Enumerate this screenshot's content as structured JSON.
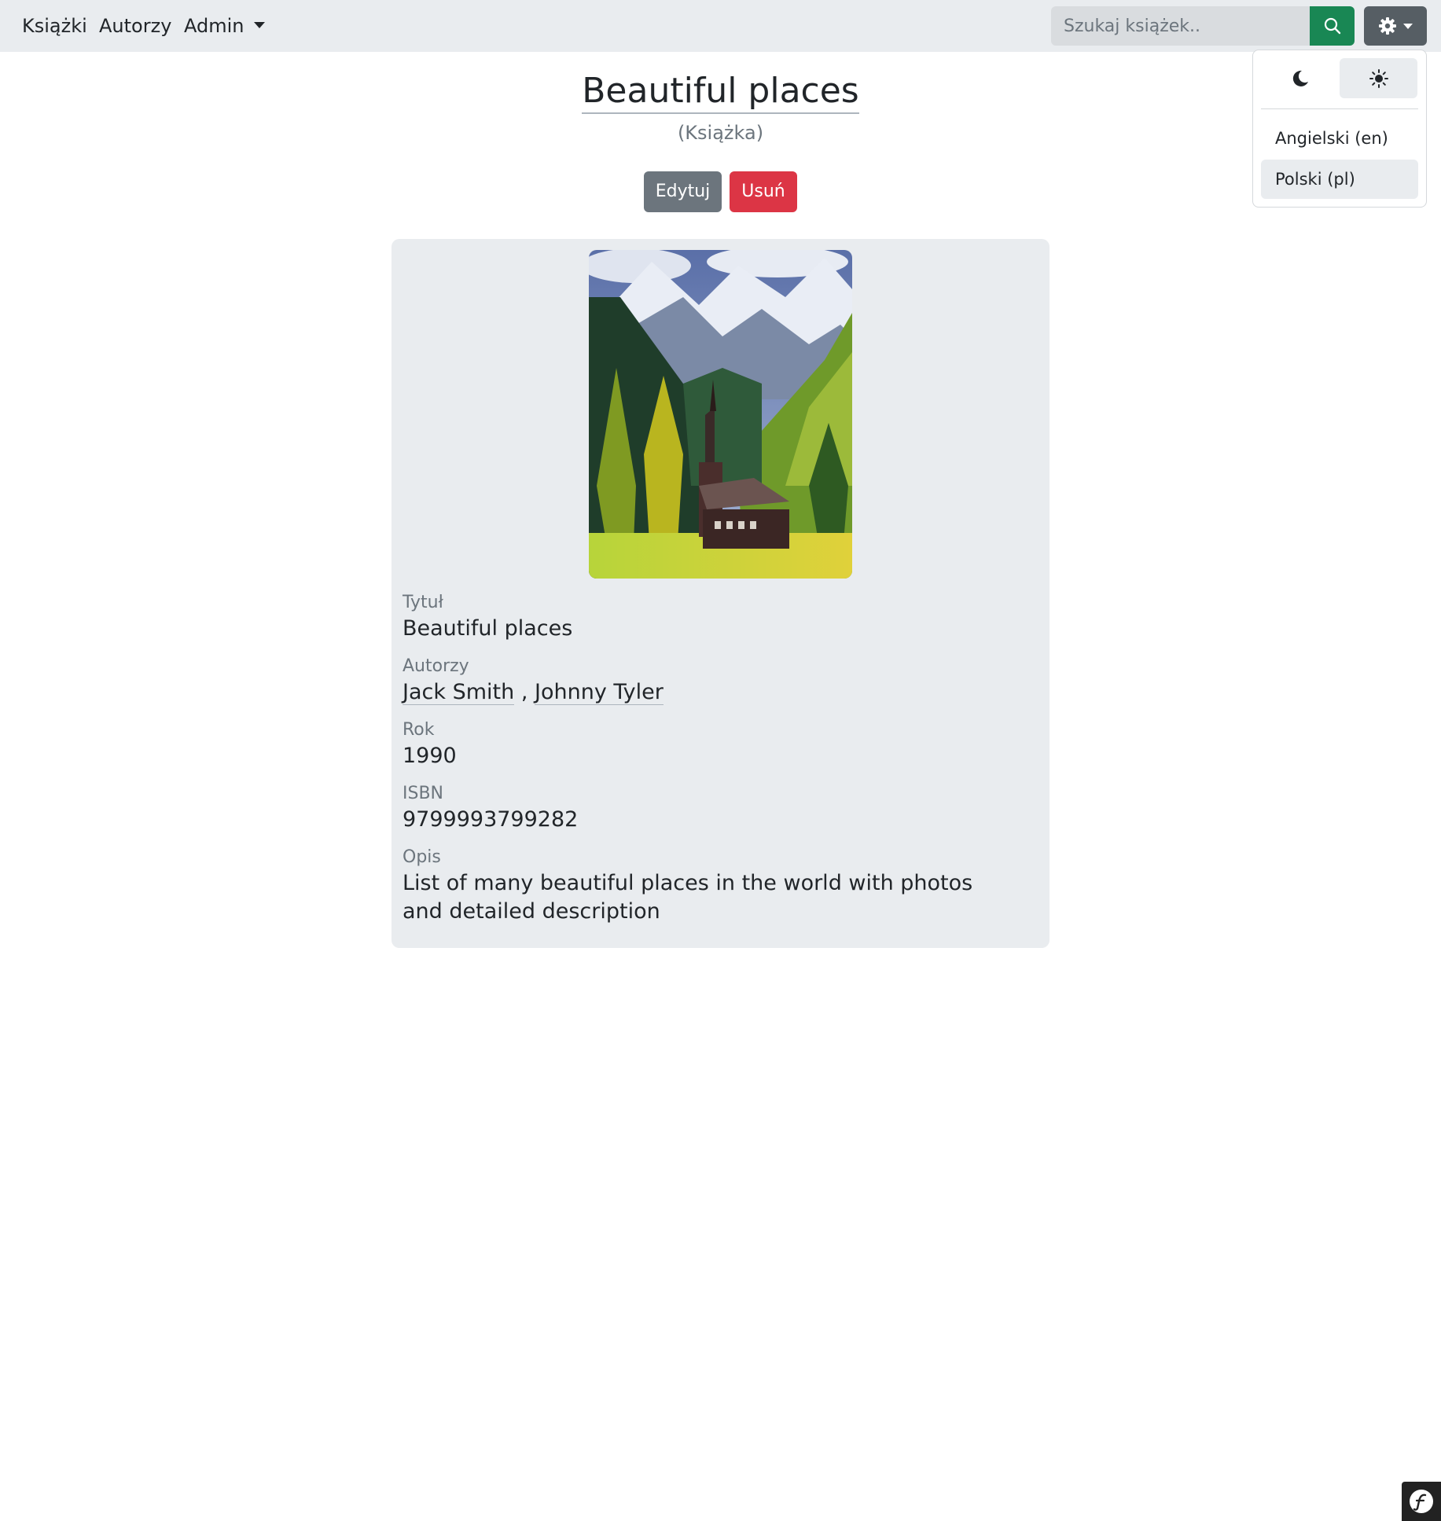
{
  "nav": {
    "books": "Książki",
    "authors": "Autorzy",
    "admin": "Admin"
  },
  "search": {
    "placeholder": "Szukaj książek.."
  },
  "settings": {
    "language_en": "Angielski (en)",
    "language_pl": "Polski (pl)"
  },
  "book": {
    "title": "Beautiful places",
    "type": "(Książka)",
    "edit_label": "Edytuj",
    "delete_label": "Usuń",
    "fields": {
      "title_label": "Tytuł",
      "title_value": "Beautiful places",
      "authors_label": "Autorzy",
      "author_1": "Jack Smith",
      "author_sep": ",",
      "author_2": "Johnny Tyler",
      "year_label": "Rok",
      "year_value": "1990",
      "isbn_label": "ISBN",
      "isbn_value": "9799993799282",
      "description_label": "Opis",
      "description_value": "List of many beautiful places in the world with photos and detailed description"
    }
  },
  "icons": {
    "search": "search-icon",
    "gear": "gear-icon",
    "moon": "moon-icon",
    "sun": "sun-icon",
    "symfony": "symfony-logo-icon"
  },
  "colors": {
    "navbar_bg": "#e9ecef",
    "search_button": "#198754",
    "gear_button": "#565e64",
    "edit_button": "#6c757d",
    "delete_button": "#dc3545",
    "card_bg": "#e9ecef"
  }
}
